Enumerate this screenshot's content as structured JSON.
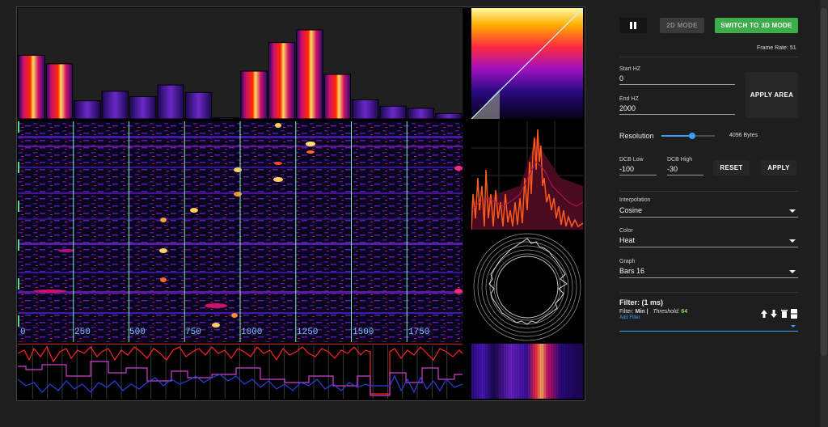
{
  "controls": {
    "pause_icon": "pause-icon",
    "mode_2d_label": "2D MODE",
    "switch_3d_label": "SWITCH TO 3D MODE",
    "frame_rate_label": "Frame Rate: 51"
  },
  "area": {
    "start_label": "Start HZ",
    "start_value": "0",
    "end_label": "End HZ",
    "end_value": "2000",
    "apply_label": "APPLY AREA"
  },
  "resolution": {
    "label": "Resolution",
    "value_text": "4096 Bytes",
    "slider_level": 0.58
  },
  "db": {
    "low_label": "DCB Low",
    "low_value": "-100",
    "high_label": "DCB High",
    "high_value": "-30",
    "reset_label": "RESET",
    "apply_label": "APPLY"
  },
  "interpolation": {
    "label": "Interpolation",
    "value": "Cosine"
  },
  "color": {
    "label": "Color",
    "value": "Heat"
  },
  "graph": {
    "label": "Graph",
    "value": "Bars 16"
  },
  "filter": {
    "title": "Filter: (1 ms)",
    "type_label": "Filter:",
    "type_value": "Min |",
    "threshold_label": "Threshold:",
    "threshold_value": "64",
    "add_label": "Add Filter"
  },
  "spectrogram": {
    "freq_ticks": [
      "0",
      "250",
      "500",
      "750",
      "1000",
      "1250",
      "1500",
      "1750"
    ]
  },
  "bars": {
    "levels": [
      0.6,
      0.52,
      0.17,
      0.26,
      0.21,
      0.32,
      0.25,
      0.01,
      0.45,
      0.72,
      0.84,
      0.42,
      0.18,
      0.12,
      0.1,
      0.05
    ]
  },
  "colors": {
    "accent_green": "#3dac4b",
    "link_blue": "#3aa0ff",
    "threshold_green": "#8edc52"
  }
}
